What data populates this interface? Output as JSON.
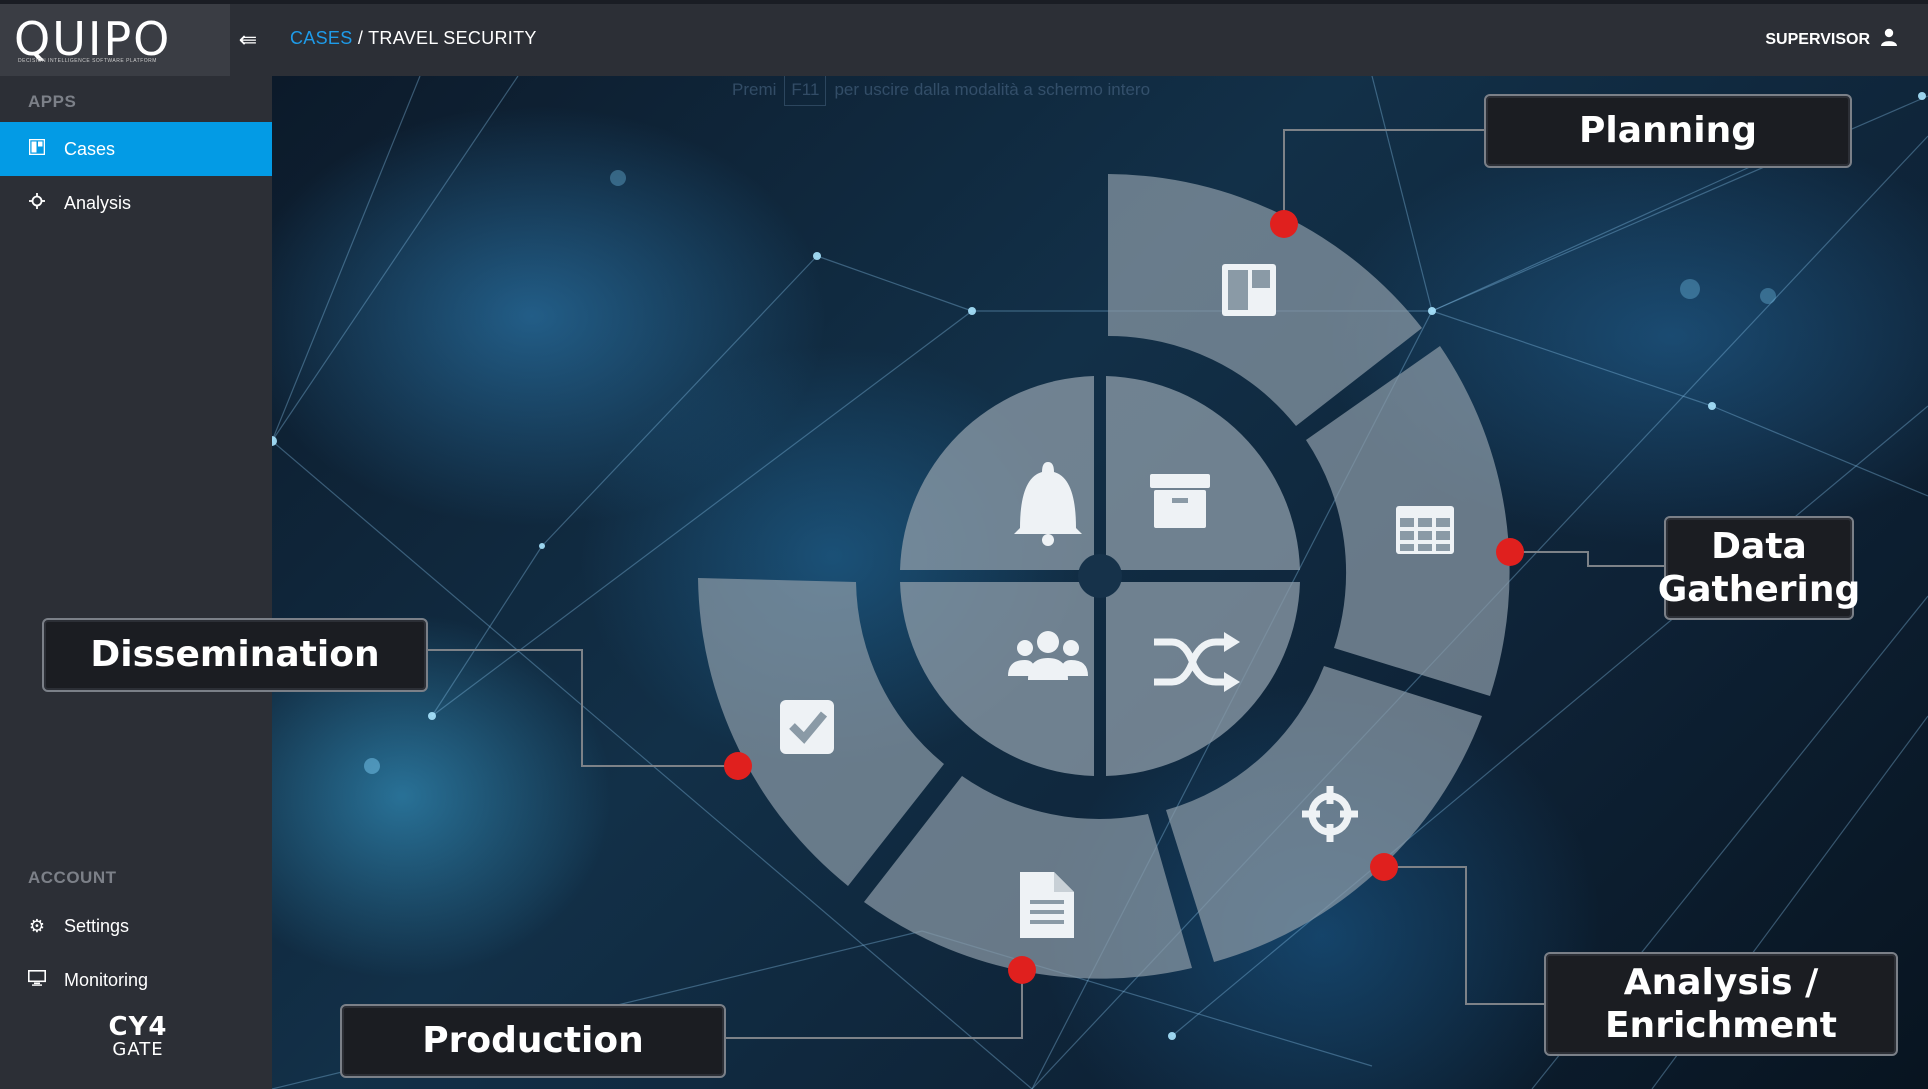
{
  "brand": {
    "logo": "QUIPO",
    "logo_tagline": "DECISION INTELLIGENCE SOFTWARE PLATFORM",
    "footer_logo_top": "CY4",
    "footer_logo_bottom": "GATE"
  },
  "sidebar": {
    "apps_heading": "APPS",
    "apps": [
      {
        "label": "Cases",
        "icon": "board-icon",
        "active": true
      },
      {
        "label": "Analysis",
        "icon": "crosshair-icon",
        "active": false
      }
    ],
    "account_heading": "ACCOUNT",
    "account": [
      {
        "label": "Settings",
        "icon": "gears-icon"
      },
      {
        "label": "Monitoring",
        "icon": "monitor-icon"
      }
    ]
  },
  "header": {
    "breadcrumb_root": "CASES",
    "breadcrumb_sep": "/",
    "breadcrumb_current": "TRAVEL SECURITY",
    "user": "SUPERVISOR"
  },
  "fullscreen_hint": {
    "before": "Premi",
    "key": "F11",
    "after": "per uscire dalla modalità a schermo intero"
  },
  "cycle": {
    "stages": [
      {
        "label": "Planning",
        "icon": "board-icon"
      },
      {
        "label": "Data",
        "label2": "Gathering",
        "icon": "table-grid-icon"
      },
      {
        "label": "Analysis /",
        "label2": "Enrichment",
        "icon": "crosshair-icon"
      },
      {
        "label": "Production",
        "icon": "document-icon"
      },
      {
        "label": "Dissemination",
        "icon": "checkbox-icon"
      }
    ],
    "core": [
      {
        "icon": "bell-icon"
      },
      {
        "icon": "archive-icon"
      },
      {
        "icon": "users-icon"
      },
      {
        "icon": "shuffle-icon"
      }
    ]
  },
  "colors": {
    "accent": "#039be5",
    "link": "#1e9be9",
    "marker": "#e0201e",
    "segment": "#8a9aa6"
  }
}
